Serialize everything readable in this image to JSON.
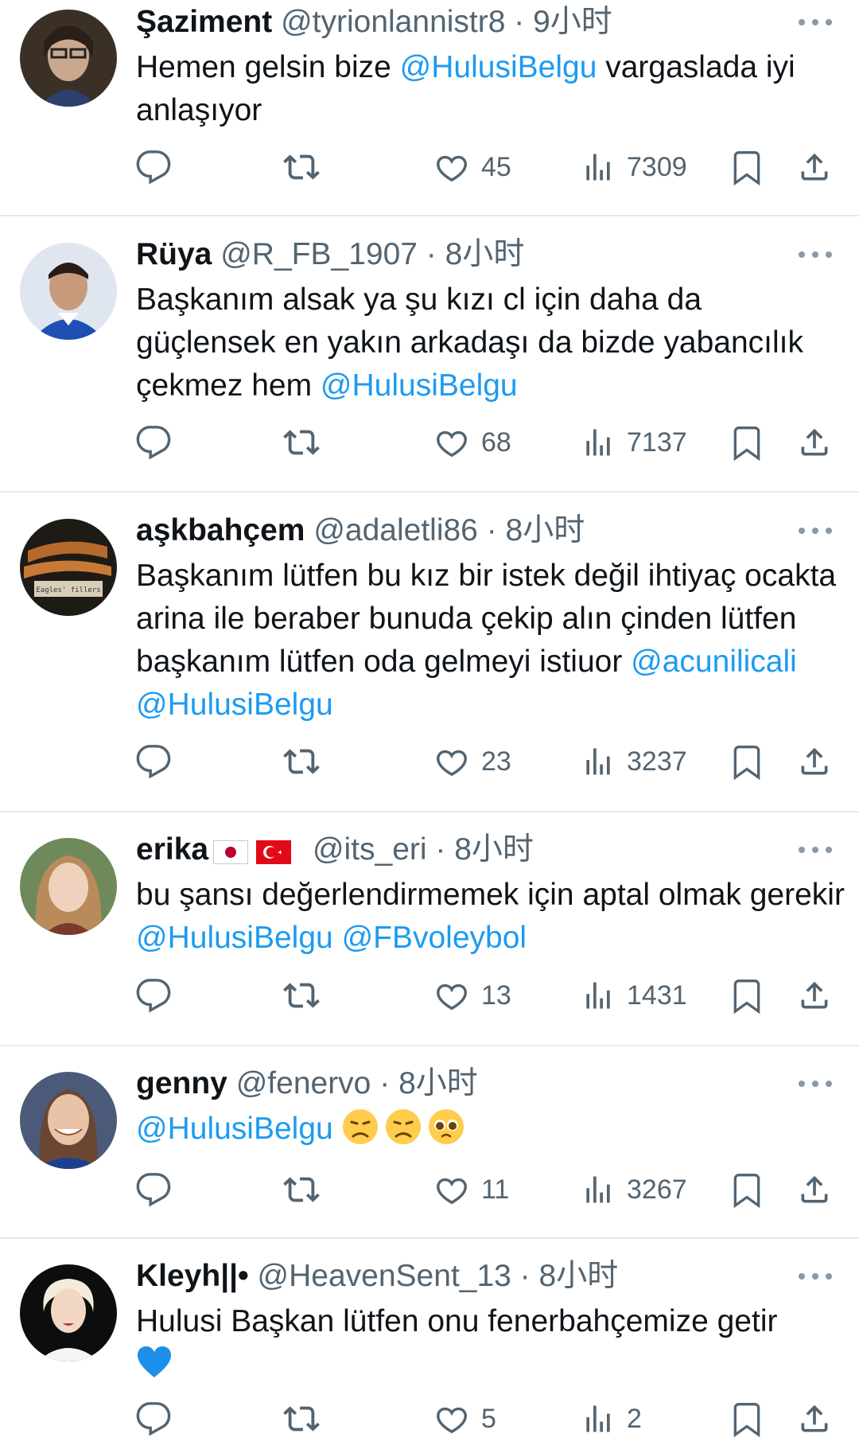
{
  "tweets": [
    {
      "name": "Şaziment",
      "handle": "@tyrionlannistr8",
      "sep": " · ",
      "time": "9小时",
      "text_parts": [
        "Hemen gelsin bize ",
        "@HulusiBelgu",
        " vargaslada iyi anlaşıyor"
      ],
      "likes": "45",
      "views": "7309"
    },
    {
      "name": "Rüya",
      "handle": "@R_FB_1907",
      "sep": " · ",
      "time": "8小时",
      "text_parts": [
        "Başkanım alsak ya şu kızı cl için daha da güçlensek en yakın arkadaşı da bizde yabancılık çekmez hem ",
        "@HulusiBelgu",
        ""
      ],
      "likes": "68",
      "views": "7137"
    },
    {
      "name": "aşkbahçem",
      "handle": "@adaletli86",
      "sep": " · ",
      "time": "8小时",
      "text_parts": [
        "Başkanım lütfen bu kız bir istek değil ihtiyaç ocakta arina ile beraber bunuda çekip alın çinden lütfen başkanım lütfen oda gelmeyi istiuor ",
        "@acunilicali",
        " ",
        "@HulusiBelgu"
      ],
      "likes": "23",
      "views": "3237"
    },
    {
      "name": "erika",
      "handle": "@its_eri",
      "sep": " · ",
      "time": "8小时",
      "text_parts": [
        "bu şansı değerlendirmemek için aptal olmak gerekir ",
        "@HulusiBelgu",
        " ",
        "@FBvoleybol"
      ],
      "likes": "13",
      "views": "1431"
    },
    {
      "name": "genny",
      "handle": "@fenervo",
      "sep": " · ",
      "time": "8小时",
      "text_parts": [
        "@HulusiBelgu",
        " "
      ],
      "likes": "11",
      "views": "3267"
    },
    {
      "name": "Kleyh||•",
      "handle": "@HeavenSent_13",
      "sep": " · ",
      "time": "8小时",
      "text_parts": [
        "Hulusi Başkan lütfen onu fenerbahçemize getir"
      ],
      "likes": "5",
      "views": "2"
    }
  ],
  "icons": {
    "reply": "reply-icon",
    "retweet": "retweet-icon",
    "like": "heart-icon",
    "views": "views-icon",
    "bookmark": "bookmark-icon",
    "share": "share-icon",
    "more": "more-icon"
  },
  "colors": {
    "mention": "#1d9bf0",
    "handle": "#536471",
    "divider": "#e7e9ec"
  }
}
